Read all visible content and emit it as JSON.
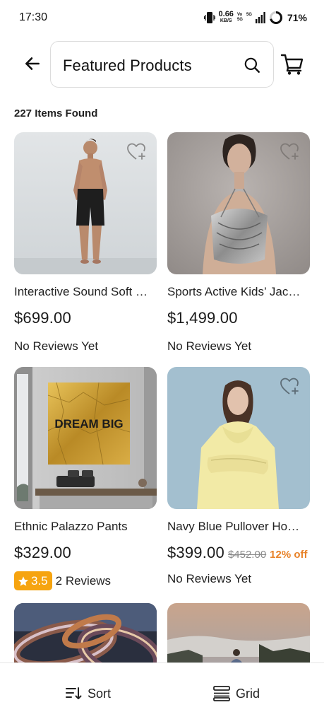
{
  "status_bar": {
    "time": "17:30",
    "net_speed_value": "0.66",
    "net_speed_unit": "KB/S",
    "volte_top": "Vo",
    "volte_bottom": "5G",
    "network_type": "5G",
    "battery_percent": "71%"
  },
  "header": {
    "search_text": "Featured Products",
    "icons": {
      "back": "arrow-left-icon",
      "search": "search-icon",
      "cart": "cart-icon"
    }
  },
  "results": {
    "count_text": "227 Items Found"
  },
  "products": [
    {
      "title": "Interactive Sound Soft …",
      "price": "$699.00",
      "reviews_text": "No Reviews Yet",
      "image": "man-in-black-shorts"
    },
    {
      "title": "Sports Active Kids’ Jac…",
      "price": "$1,499.00",
      "reviews_text": "No Reviews Yet",
      "image": "woman-in-silver-halter-top"
    },
    {
      "title": "Ethnic Palazzo Pants",
      "price": "$329.00",
      "rating": "3.5",
      "reviews_text": "2 Reviews",
      "image": "gold-dream-big-canvas",
      "image_text": "DREAM BIG"
    },
    {
      "title": "Navy Blue Pullover Ho…",
      "price": "$399.00",
      "old_price": "$452.00",
      "discount": "12% off",
      "reviews_text": "No Reviews Yet",
      "image": "woman-in-yellow-hoodie"
    },
    {
      "image": "abstract-glossy-rings"
    },
    {
      "image": "person-above-clouds"
    }
  ],
  "bottom_bar": {
    "sort_label": "Sort",
    "grid_label": "Grid",
    "icons": {
      "sort": "sort-icon",
      "grid": "grid-view-icon"
    }
  },
  "colors": {
    "rating_badge": "#f6a410",
    "discount": "#e8832a",
    "old_price": "#8a8a8a",
    "text_primary": "#1a1a1a"
  }
}
